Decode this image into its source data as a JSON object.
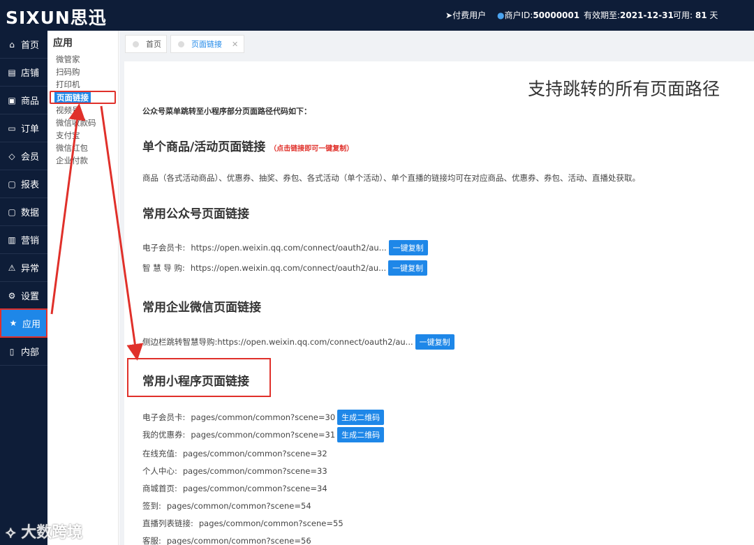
{
  "header": {
    "logo": "SIXUN思迅",
    "paid_user": "付费用户",
    "merchant_label": "商户ID:",
    "merchant_id": "50000001",
    "expiry_label": "有效期至:",
    "expiry_date": "2021-12-31",
    "avail_label": "可用:",
    "avail_days": "81",
    "avail_unit": "天"
  },
  "leftnav": [
    {
      "label": "首页",
      "icon": "home-icon"
    },
    {
      "label": "店铺",
      "icon": "store-icon"
    },
    {
      "label": "商品",
      "icon": "gift-icon"
    },
    {
      "label": "订单",
      "icon": "order-icon"
    },
    {
      "label": "会员",
      "icon": "diamond-icon"
    },
    {
      "label": "报表",
      "icon": "report-icon"
    },
    {
      "label": "数据",
      "icon": "data-icon"
    },
    {
      "label": "营销",
      "icon": "bar-chart-icon"
    },
    {
      "label": "异常",
      "icon": "warning-icon"
    },
    {
      "label": "设置",
      "icon": "gear-icon"
    },
    {
      "label": "应用",
      "icon": "star-icon"
    },
    {
      "label": "内部",
      "icon": "document-icon"
    }
  ],
  "submenu": {
    "title": "应用",
    "items": [
      "微管家",
      "扫码购",
      "打印机",
      "页面链接",
      "视频号",
      "微信收款码",
      "支付宝",
      "微信红包",
      "企业付款"
    ]
  },
  "tabs": [
    {
      "label": "首页"
    },
    {
      "label": "页面链接"
    }
  ],
  "main": {
    "title": "支持跳转的所有页面路径",
    "intro": "公众号菜单跳转至小程序部分页面路径代码如下：",
    "s1_title": "单个商品/活动页面链接",
    "s1_note": "（点击链接即可一键复制）",
    "s1_para": "商品（各式活动商品）、优惠券、抽奖、券包、各式活动（单个活动）、单个直播的链接均可在对应商品、优惠券、券包、活动、直播处获取。",
    "s2_title": "常用公众号页面链接",
    "s2_rows": [
      {
        "label": "电子会员卡:",
        "url": "https://open.weixin.qq.com/connect/oauth2/au...",
        "button": "一键复制"
      },
      {
        "label": "智 慧 导 购:",
        "url": "https://open.weixin.qq.com/connect/oauth2/au...",
        "button": "一键复制"
      }
    ],
    "s3_title": "常用企业微信页面链接",
    "s3_rows": [
      {
        "label": "侧边栏跳转智慧导购:",
        "url": "https://open.weixin.qq.com/connect/oauth2/au...",
        "button": "一键复制"
      }
    ],
    "s4_title": "常用小程序页面链接",
    "s4_rows": [
      {
        "label": "电子会员卡:",
        "path": "pages/common/common?scene=30",
        "button": "生成二维码"
      },
      {
        "label": "我的优惠券:",
        "path": "pages/common/common?scene=31",
        "button": "生成二维码"
      },
      {
        "label": "在线充值:",
        "path": "pages/common/common?scene=32"
      },
      {
        "label": "个人中心:",
        "path": "pages/common/common?scene=33"
      },
      {
        "label": "商城首页:",
        "path": "pages/common/common?scene=34"
      },
      {
        "label": "签到:",
        "path": "pages/common/common?scene=54"
      },
      {
        "label": "直播列表链接:",
        "path": "pages/common/common?scene=55"
      },
      {
        "label": "客服:",
        "path": "pages/common/common?scene=56"
      }
    ]
  },
  "watermark": "大数跨境",
  "colors": {
    "nav_bg": "#0e1d38",
    "accent": "#1e87e8",
    "highlight_red": "#e0302a"
  }
}
